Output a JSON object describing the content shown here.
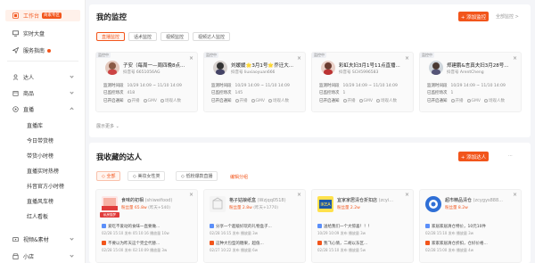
{
  "sidebar": {
    "items": [
      {
        "label": "工作台",
        "badge": "商家专区"
      },
      {
        "label": "实时大盘"
      },
      {
        "label": "服务指南"
      },
      {
        "label": "达人"
      },
      {
        "label": "商品"
      },
      {
        "label": "直播"
      },
      {
        "label": "视频&素材"
      },
      {
        "label": "小店"
      }
    ],
    "live_sub": [
      "直播库",
      "今日带货榜",
      "带货小时榜",
      "直播实时热榜",
      "抖音官方小时榜",
      "直播风车榜",
      "红人看板"
    ]
  },
  "monitor": {
    "title": "我的监控",
    "add_button": "+ 添加监控",
    "all_link": "全部监控 >",
    "tabs": [
      "直播监控",
      "话术监控",
      "视频监控",
      "视频达人监控"
    ],
    "show_more": "展示更多",
    "cards": [
      {
        "tag": "监控中",
        "name": "子安（每周一—周四晚8点...",
        "sub": "抖音号 6651056AG",
        "time": "10/29 14:09 ~ 11/10 14:09",
        "count": "418",
        "opts": [
          "开播",
          "GMV",
          "场观人数"
        ]
      },
      {
        "tag": "监控中",
        "name": "刘媛媛🌟3月1号🌟乔迁大...",
        "sub": "抖音号 liuxiaoyuan666",
        "time": "10/29 14:09 ~ 11/10 14:09",
        "count": "145",
        "opts": [
          "开播",
          "GMV",
          "场观人数"
        ]
      },
      {
        "tag": "监控中",
        "name": "彩虹夫妇3月1号11点直播...",
        "sub": "抖音号 SCH5996583",
        "time": "10/29 14:09 ~ 11/10 14:09",
        "count": "1",
        "opts": [
          "开播",
          "GMV",
          "场观人数"
        ]
      },
      {
        "tag": "监控中",
        "name": "郑建鹏&言真夫妇3月28号...",
        "sub": "抖音号 ArentCheng",
        "time": "10/29 14:09 ~ 11/10 14:09",
        "count": "1",
        "opts": [
          "开播",
          "GMV",
          "场观人数"
        ]
      }
    ],
    "row_labels": {
      "time": "监测时间段",
      "count": "已监控场次",
      "notify": "已开启通知"
    }
  },
  "fav": {
    "title": "我收藏的达人",
    "add_button": "+ 添加达人",
    "chips": [
      "全部",
      "美妆女性类",
      "低粉爆款直播",
      "编辑分组"
    ],
    "cards": [
      {
        "name": "食味的初相",
        "handle": "(shiweifood)",
        "sub": "粉丝量 65.8w",
        "sub2": "(昨天+540)",
        "badge": "私房猫梦",
        "r1": "爱吃不爱动的食味一直要做...",
        "r1v": "播放量 10w",
        "m1": "02/28 15:10 发布 05:10:16",
        "r2": "不要以为昨天这个完全代替...",
        "r2v": "播放量 3w",
        "m2": "02/28 15:00 发布 02:10:09"
      },
      {
        "name": "格子姑娘纸盒",
        "handle": "(Wzjqq0518)",
        "sub": "粉丝量 2.8w",
        "sub2": "(昨天+1770)",
        "badge": "",
        "r1": "分享一个超级好玩的礼物盒子...",
        "r1v": "播放量 3w",
        "m1": "02/28 16:15 发布",
        "r2": "这种大包型的糖果，超值...",
        "r2v": "播放量 6w",
        "m2": "02/27 10:22 发布"
      },
      {
        "name": "宜家家居清仓折扣店",
        "handle": "(zcyi...",
        "sub": "粉丝量 2.2w",
        "sub2": "",
        "badge": "",
        "r1": "送给我们一个大惊喜！！！",
        "r1v": "播放量 3w",
        "m1": "10/29 10:09 发布",
        "r2": "我飞心情，二胡以东区...",
        "r2v": "播放量 5w",
        "m2": "02/28 15:10 发布"
      },
      {
        "name": "超市精品清仓",
        "handle": "(zcygys888...",
        "sub": "粉丝量 8.2w",
        "sub2": "",
        "badge": "",
        "r1": "家居家居清仓特价，10元10件",
        "r1v": "播放量 3w",
        "m1": "02/28 15:10 发布",
        "r2": "家家家居清仓折扣，仓好价格...",
        "r2v": "播放量 4w",
        "m2": "02/28 15:00 发布"
      }
    ]
  },
  "colors": {
    "accent": "#f2551b"
  }
}
